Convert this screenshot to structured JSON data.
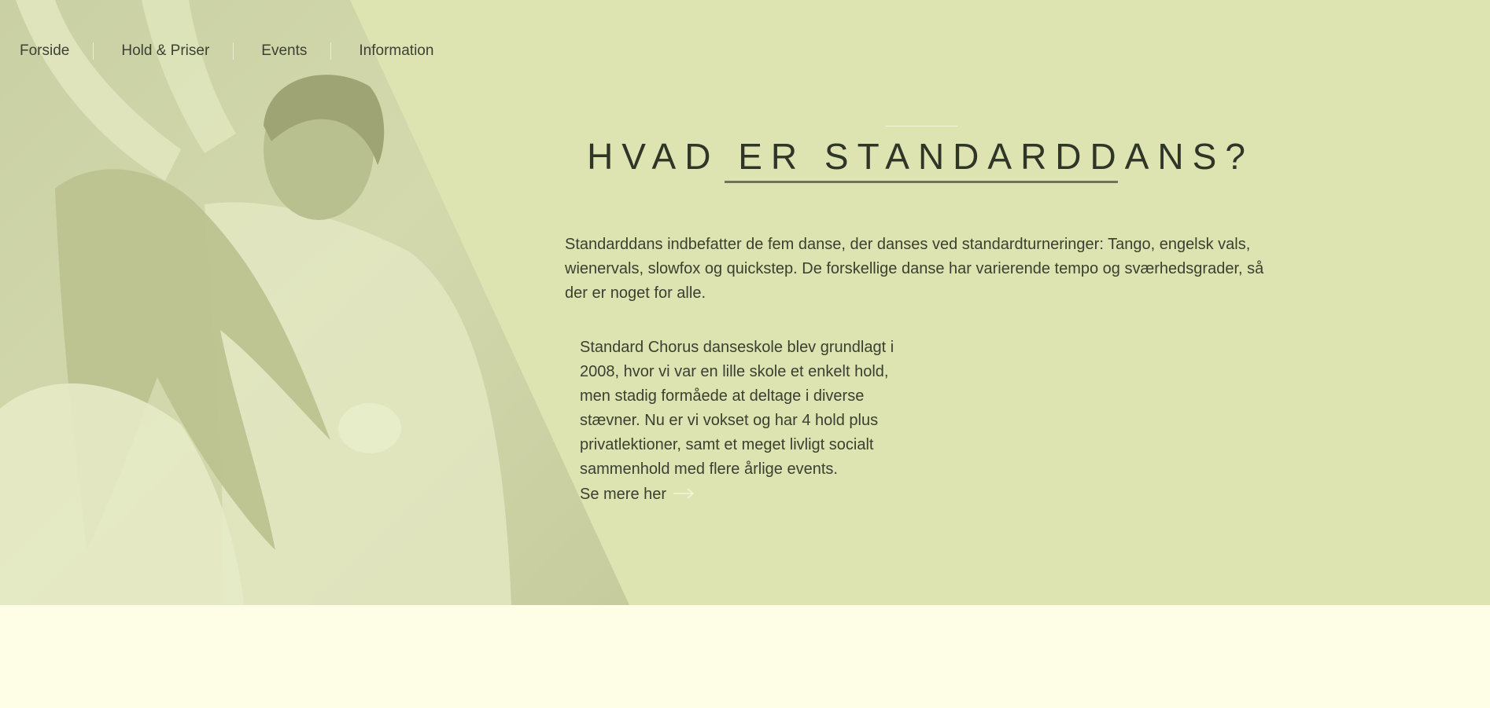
{
  "nav": {
    "items": [
      {
        "label": "Forside"
      },
      {
        "label": "Hold & Priser"
      },
      {
        "label": "Events"
      },
      {
        "label": "Information"
      }
    ]
  },
  "main": {
    "heading": "HVAD ER STANDARDDANS?",
    "intro": "Standarddans indbefatter de fem danse, der danses ved standardturneringer: Tango, engelsk vals, wienervals, slowfox og quickstep. De forskellige danse har varierende tempo og sværhedsgrader, så der er noget for alle.",
    "about_lines": [
      "Standard Chorus danseskole blev grundlagt i",
      "2008, hvor vi var en lille skole et enkelt hold,",
      "men stadig formåede at deltage i diverse",
      "stævner. Nu er vi vokset og har 4 hold plus",
      "privatlektioner, samt et meget livligt socialt",
      "sammenhold med flere årlige events."
    ],
    "see_more_label": "Se mere her"
  },
  "icons": {
    "arrow": "arrow-right-icon"
  },
  "colors": {
    "hero_background": "#dde3b1",
    "page_background": "#fefee6",
    "heading_underline": "#6d7458",
    "text": "#333b2c"
  }
}
